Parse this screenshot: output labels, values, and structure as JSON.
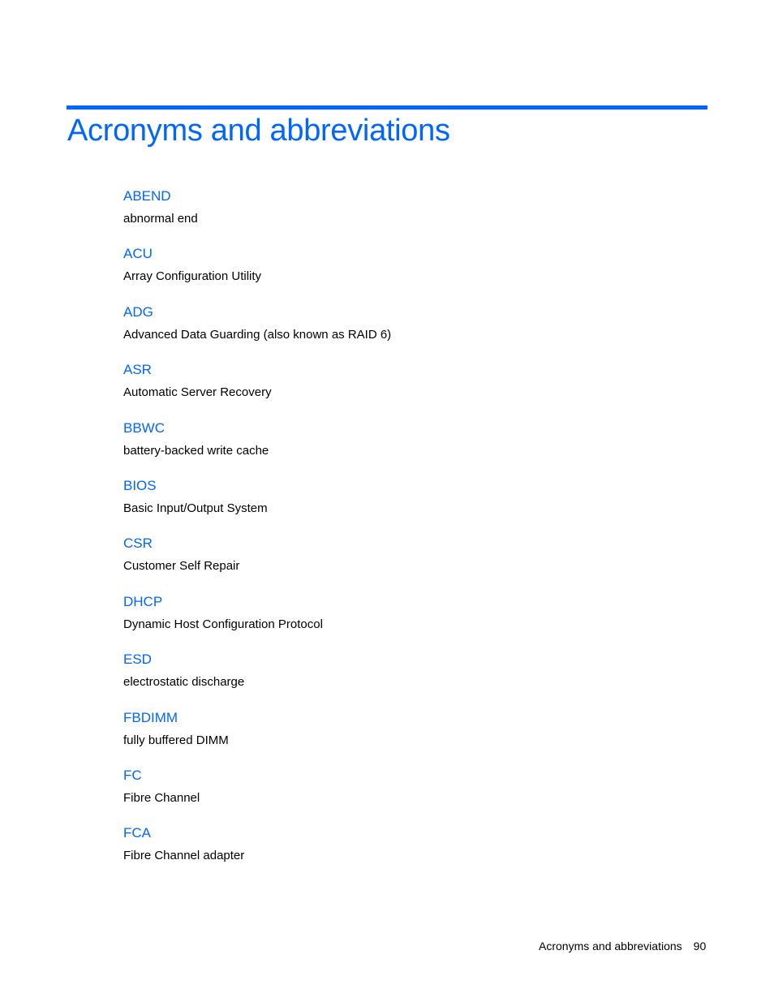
{
  "page": {
    "title": "Acronyms and abbreviations",
    "entries": [
      {
        "term": "ABEND",
        "definition": "abnormal end"
      },
      {
        "term": "ACU",
        "definition": "Array Configuration Utility"
      },
      {
        "term": "ADG",
        "definition": "Advanced Data Guarding (also known as RAID 6)"
      },
      {
        "term": "ASR",
        "definition": "Automatic Server Recovery"
      },
      {
        "term": "BBWC",
        "definition": "battery-backed write cache"
      },
      {
        "term": "BIOS",
        "definition": "Basic Input/Output System"
      },
      {
        "term": "CSR",
        "definition": "Customer Self Repair"
      },
      {
        "term": "DHCP",
        "definition": "Dynamic Host Configuration Protocol"
      },
      {
        "term": "ESD",
        "definition": "electrostatic discharge"
      },
      {
        "term": "FBDIMM",
        "definition": "fully buffered DIMM"
      },
      {
        "term": "FC",
        "definition": "Fibre Channel"
      },
      {
        "term": "FCA",
        "definition": "Fibre Channel adapter"
      }
    ],
    "footer": {
      "section": "Acronyms and abbreviations",
      "page_number": "90"
    }
  },
  "colors": {
    "accent": "#0066ff"
  }
}
